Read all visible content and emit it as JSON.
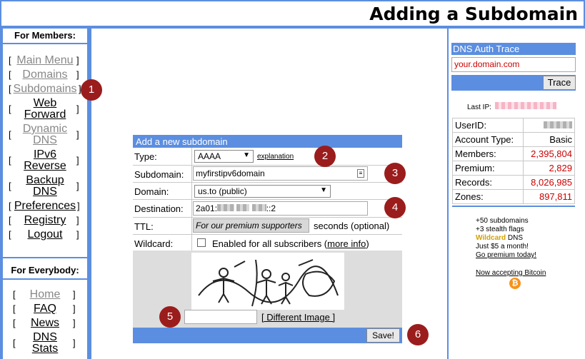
{
  "page": {
    "title": "Adding a Subdomain"
  },
  "members": {
    "heading": "For Members:",
    "items": [
      {
        "label": "Main Menu"
      },
      {
        "label": "Domains"
      },
      {
        "label": "Subdomains"
      },
      {
        "label": "Web Forward"
      },
      {
        "label": "Dynamic DNS"
      },
      {
        "label": "IPv6 Reverse"
      },
      {
        "label": "Backup DNS"
      },
      {
        "label": "Preferences"
      },
      {
        "label": "Registry"
      },
      {
        "label": "Logout"
      }
    ]
  },
  "everybody": {
    "heading": "For Everybody:",
    "items": [
      {
        "label": "Home"
      },
      {
        "label": "FAQ"
      },
      {
        "label": "News"
      },
      {
        "label": "DNS Stats"
      }
    ]
  },
  "form": {
    "header": "Add a new subdomain",
    "type_label": "Type:",
    "type_value": "AAAA",
    "explanation": "explanation",
    "subdomain_label": "Subdomain:",
    "subdomain_value": "myfirstipv6domain",
    "domain_label": "Domain:",
    "domain_value": "us.to (public)",
    "destination_label": "Destination:",
    "destination_prefix": "2a01:",
    "destination_suffix": "::2",
    "ttl_label": "TTL:",
    "ttl_value": "For our premium supporters",
    "ttl_suffix": "seconds (optional)",
    "wildcard_label": "Wildcard:",
    "wildcard_text": "Enabled for all subscribers (",
    "more_info": "more info",
    "wildcard_close": ")",
    "captcha_value": "",
    "different_image": "[ Different Image ]",
    "save": "Save!"
  },
  "markers": [
    "1",
    "2",
    "3",
    "4",
    "5",
    "6"
  ],
  "right": {
    "trace_heading": "DNS Auth Trace",
    "trace_placeholder": "your.domain.com",
    "trace_button": "Trace",
    "last_ip_label": "Last IP:",
    "stats": [
      {
        "label": "UserID:",
        "value": ""
      },
      {
        "label": "Account Type:",
        "value": "Basic"
      },
      {
        "label": "Members:",
        "value": "2,395,804"
      },
      {
        "label": "Premium:",
        "value": "2,829"
      },
      {
        "label": "Records:",
        "value": "8,026,985"
      },
      {
        "label": "Zones:",
        "value": "897,811"
      }
    ],
    "promo": {
      "line1": "+50 subdomains",
      "line2": "+3 stealth flags",
      "wildcard_word": "Wildcard",
      "dns_word": " DNS",
      "line4": "Just $5 a month!",
      "link": "Go premium today!",
      "bitcoin": "Now accepting Bitcoin"
    }
  },
  "colors": {
    "accent": "#5b8ee0",
    "marker": "#9b1c1c",
    "stat_value": "#cc0000"
  },
  "icons": {
    "bitcoin": "bitcoin-icon",
    "checkbox": "checkbox-icon",
    "dropdown": "chevron-down-icon"
  }
}
